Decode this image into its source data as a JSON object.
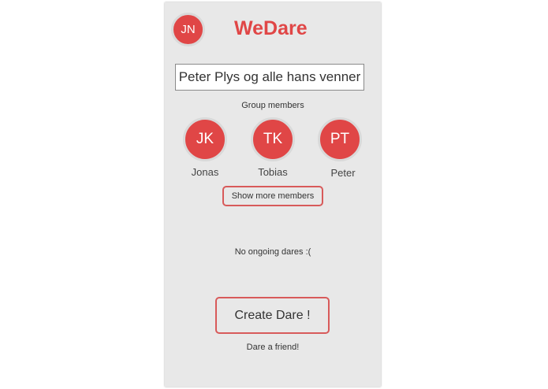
{
  "header": {
    "user_initials": "JN",
    "app_title": "WeDare"
  },
  "group": {
    "name": "Peter Plys og alle hans venner"
  },
  "members": {
    "heading": "Group members",
    "items": [
      {
        "initials": "JK",
        "name": "Jonas"
      },
      {
        "initials": "TK",
        "name": "Tobias"
      },
      {
        "initials": "PT",
        "name": "Peter"
      }
    ],
    "show_more_label": "Show more members"
  },
  "dares": {
    "empty_text": "No ongoing dares :("
  },
  "actions": {
    "create_label": "Create Dare !",
    "subtext": "Dare a friend!"
  },
  "colors": {
    "accent": "#e04646",
    "background": "#e8e8e8"
  }
}
